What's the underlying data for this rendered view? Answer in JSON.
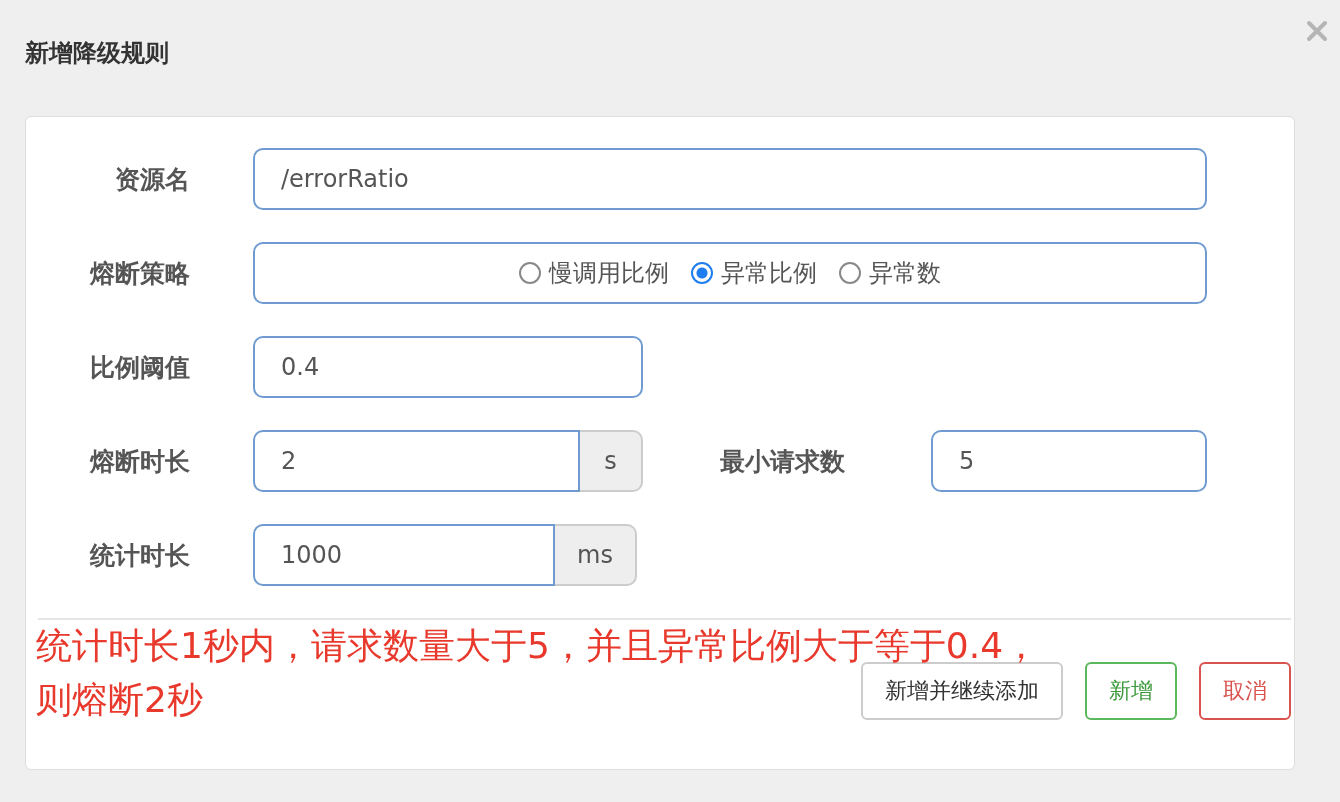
{
  "dialog": {
    "title": "新增降级规则"
  },
  "rows": [
    {
      "label": "资源名",
      "kind": "wide",
      "value": "/errorRatio"
    },
    {
      "label": "熔断策略",
      "kind": "radio",
      "options": [
        {
          "label": "慢调用比例",
          "selected": false
        },
        {
          "label": "异常比例",
          "selected": true
        },
        {
          "label": "异常数",
          "selected": false
        }
      ]
    },
    {
      "label": "比例阈值",
      "kind": "short",
      "value": "0.4"
    },
    {
      "label": "熔断时长",
      "kind": "unit",
      "value": "2",
      "unit": "s",
      "extra": {
        "label": "最小请求数",
        "value": "5"
      }
    },
    {
      "label": "统计时长",
      "kind": "unit",
      "value": "1000",
      "unit": "ms"
    }
  ],
  "annotation": [
    "统计时长1秒内，请求数量大于5，并且异常比例大于等于0.4，",
    "则熔断2秒"
  ],
  "buttons": [
    {
      "label": "新增并继续添加",
      "kind": "default"
    },
    {
      "label": "新增",
      "kind": "success"
    },
    {
      "label": "取消",
      "kind": "danger"
    }
  ]
}
